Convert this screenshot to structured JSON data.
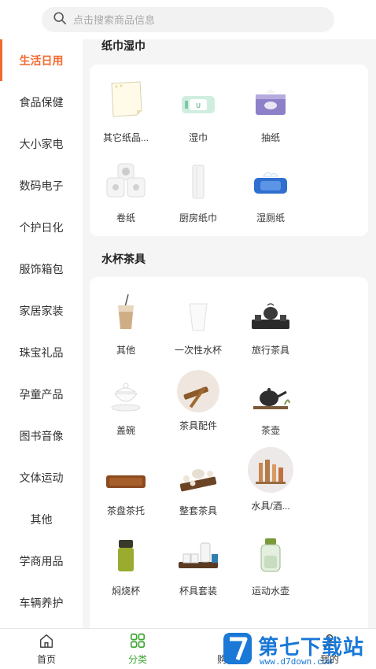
{
  "search": {
    "placeholder": "点击搜索商品信息"
  },
  "sidebar": {
    "items": [
      {
        "label": "生活日用",
        "active": true
      },
      {
        "label": "食品保健"
      },
      {
        "label": "大小家电"
      },
      {
        "label": "数码电子"
      },
      {
        "label": "个护日化"
      },
      {
        "label": "服饰箱包"
      },
      {
        "label": "家居家装"
      },
      {
        "label": "珠宝礼品"
      },
      {
        "label": "孕童产品"
      },
      {
        "label": "图书音像"
      },
      {
        "label": "文体运动"
      },
      {
        "label": "其他"
      },
      {
        "label": "学商用品"
      },
      {
        "label": "车辆养护"
      }
    ]
  },
  "sections": [
    {
      "title": "纸巾湿巾",
      "items": [
        {
          "label": "其它纸品...",
          "icon": "napkin-icon"
        },
        {
          "label": "湿巾",
          "icon": "wet-wipes-icon"
        },
        {
          "label": "抽纸",
          "icon": "tissue-box-icon"
        },
        {
          "label": "卷纸",
          "icon": "toilet-roll-icon"
        },
        {
          "label": "厨房纸巾",
          "icon": "kitchen-roll-icon"
        },
        {
          "label": "湿厕纸",
          "icon": "wet-toilet-paper-icon"
        }
      ]
    },
    {
      "title": "水杯茶具",
      "items": [
        {
          "label": "其他",
          "icon": "milk-tea-cup-icon"
        },
        {
          "label": "一次性水杯",
          "icon": "paper-cup-icon"
        },
        {
          "label": "旅行茶具",
          "icon": "travel-tea-set-icon"
        },
        {
          "label": "盖碗",
          "icon": "gaiwan-icon"
        },
        {
          "label": "茶具配件",
          "icon": "tea-tools-icon"
        },
        {
          "label": "茶壶",
          "icon": "teapot-icon"
        },
        {
          "label": "茶盘茶托",
          "icon": "tea-tray-icon"
        },
        {
          "label": "整套茶具",
          "icon": "tea-set-icon"
        },
        {
          "label": "水具/酒...",
          "icon": "drinkware-icon"
        },
        {
          "label": "焖烧杯",
          "icon": "thermal-cup-icon"
        },
        {
          "label": "杯具套装",
          "icon": "cup-set-icon"
        },
        {
          "label": "运动水壶",
          "icon": "sports-bottle-icon"
        }
      ]
    }
  ],
  "tabbar": {
    "items": [
      {
        "label": "首页",
        "icon": "home-icon"
      },
      {
        "label": "分类",
        "icon": "category-icon",
        "active": true
      },
      {
        "label": "购物车",
        "icon": "cart-icon"
      },
      {
        "label": "我的",
        "icon": "user-icon"
      }
    ]
  },
  "watermark": {
    "text": "第七下载站",
    "url": "www.d7down.com"
  },
  "colors": {
    "accent": "#f26a2e",
    "tab_active": "#3fa535",
    "watermark": "#1a78d6"
  }
}
